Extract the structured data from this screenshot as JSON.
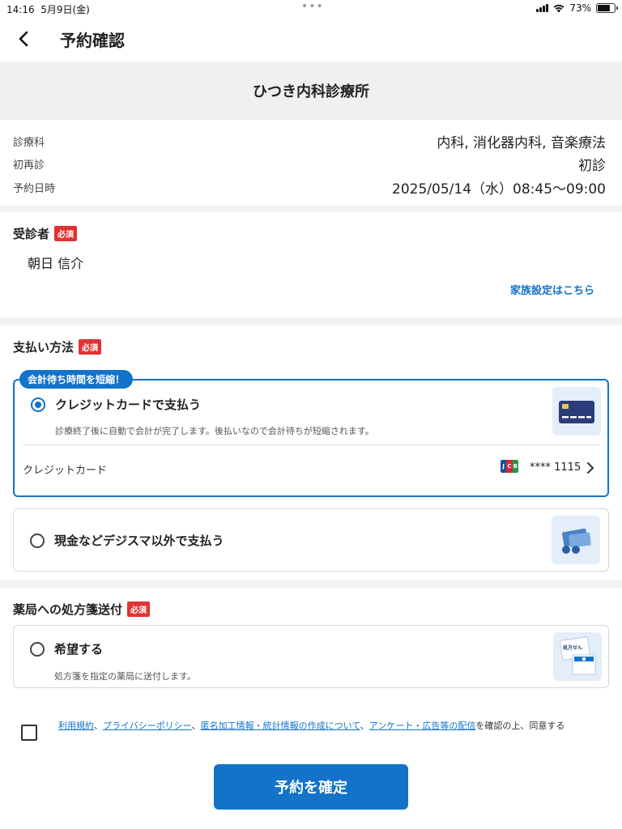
{
  "status_bar": {
    "time": "14:16",
    "date": "5月9日(金)",
    "battery": "73%",
    "battery_level": 0.73
  },
  "nav": {
    "title": "予約確認"
  },
  "clinic": {
    "name": "ひつき内科診療所"
  },
  "info": {
    "rows": [
      {
        "label": "診療科",
        "value": "内科, 消化器内科, 音楽療法"
      },
      {
        "label": "初再診",
        "value": "初診"
      },
      {
        "label": "予約日時",
        "value": "2025/05/14（水）08:45〜09:00"
      }
    ]
  },
  "patient": {
    "title": "受診者",
    "required": "必須",
    "name": "朝日 信介",
    "family_link": "家族設定はこちら"
  },
  "payment": {
    "title": "支払い方法",
    "required": "必須",
    "promo_tag": "会計待ち時間を短縮！",
    "card_option": {
      "label": "クレジットカードで支払う",
      "description": "診療終了後に自動で会計が完了します。後払いなので会計待ちが短縮されます。",
      "card_type_label": "クレジットカード",
      "card_brand": "JCB",
      "card_number": "**** 1115"
    },
    "cash_option": {
      "label": "現金などデジスマ以外で支払う"
    }
  },
  "pharmacy": {
    "title": "薬局への処方箋送付",
    "required": "必須",
    "option_label": "希望する",
    "option_desc": "処方箋を指定の薬局に送付します。",
    "thumb_label": "処方せん"
  },
  "terms": {
    "link1": "利用規約",
    "sep1": "、",
    "link2": "プライバシーポリシー",
    "sep2": "、",
    "link3": "匿名加工情報・統計情報の作成について",
    "sep3": "、",
    "link4": "アンケート・広告等の配信",
    "suffix": "を確認の上、同意する"
  },
  "confirm_button": "予約を確定",
  "colors": {
    "accent": "#1273c9",
    "required": "#e03333"
  }
}
